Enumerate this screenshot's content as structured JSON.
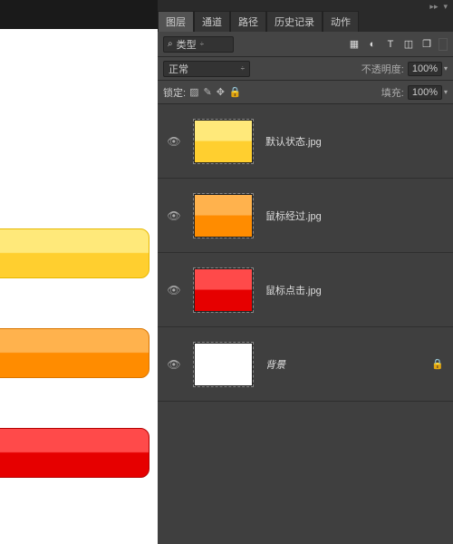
{
  "tabs": {
    "t1": "图层",
    "t2": "通道",
    "t3": "路径",
    "t4": "历史记录",
    "t5": "动作"
  },
  "search": {
    "kind_label": "类型"
  },
  "blend": {
    "mode": "正常",
    "opacity_label": "不透明度:",
    "opacity_value": "100%"
  },
  "lock_row": {
    "label": "锁定:",
    "fill_label": "填充:",
    "fill_value": "100%"
  },
  "layers": [
    {
      "name": "默认状态.jpg",
      "thumb": "th-yellow",
      "locked": false,
      "italic": false
    },
    {
      "name": "鼠标经过.jpg",
      "thumb": "th-orange",
      "locked": false,
      "italic": false
    },
    {
      "name": "鼠标点击.jpg",
      "thumb": "th-red",
      "locked": false,
      "italic": false
    },
    {
      "name": "背景",
      "thumb": "th-white",
      "locked": true,
      "italic": true
    }
  ]
}
